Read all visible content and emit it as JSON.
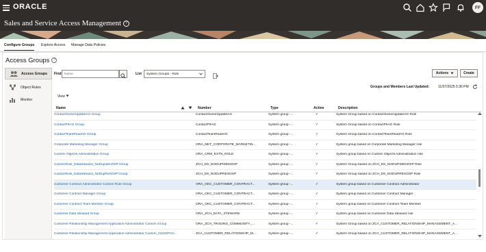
{
  "header": {
    "brand": "ORACLE",
    "page_title": "Sales and Service Access Management",
    "help_glyph": "?",
    "user_initials": "FF",
    "icons": [
      "hamburger-icon",
      "search-icon",
      "home-icon",
      "star-icon",
      "flag-icon",
      "bell-icon"
    ]
  },
  "tabs": [
    "Configure Groups",
    "Explore Access",
    "Manage Data Policies"
  ],
  "section": {
    "title": "Access Groups",
    "help_glyph": "?"
  },
  "leftnav": [
    {
      "label": "Access Groups",
      "icon": "access-groups-icon",
      "active": true
    },
    {
      "label": "Object Rules",
      "icon": "object-rules-icon",
      "active": false
    },
    {
      "label": "Monitor",
      "icon": "monitor-icon",
      "active": false
    }
  ],
  "toolbar": {
    "find_label": "Find",
    "find_placeholder": "Name",
    "list_label": "List",
    "list_value": "System Groups - Role",
    "actions_label": "Actions",
    "create_label": "Create",
    "last_updated_label": "Groups and Members Last Updated:",
    "last_updated_value": "11/07/2025 5:36 PM",
    "view_label": "View"
  },
  "columns": [
    "Name",
    "Number",
    "Type",
    "Active",
    "Description"
  ],
  "rows": [
    {
      "name": "ContactOwnerUpdateAG Group",
      "number": "ContactOwnerUpdateAG",
      "type": "System group -...",
      "active": "✓",
      "description": "System Group based on ContactOwnerUpdateAG Role"
    },
    {
      "name": "ContactPIIAG Group",
      "number": "ContactPIIAG",
      "type": "System group -...",
      "active": "✓",
      "description": "System Group based on ContactPIIAG Role"
    },
    {
      "name": "ContactTeamReadAG Group",
      "number": "ContactTeamReadAG",
      "type": "System group -...",
      "active": "✓",
      "description": "System Group based on ContactTeamReadAG Role"
    },
    {
      "name": "Corporate Marketing Manager Group",
      "number": "ORA_MKT_CORPORATE_MARKETIN...",
      "type": "System group -...",
      "active": "✓",
      "description": "System group based on Corporate Marketing Manager role"
    },
    {
      "name": "Custom Objects Administration Group",
      "number": "ORA_CRM_EXTN_ROLE",
      "type": "System group -...",
      "active": "✓",
      "description": "System group based on Custom Objects Administration role"
    },
    {
      "name": "CustomRole_DataSteward_NoDupIdenOSP Group",
      "number": "ZCH_DS_NODUPIDENOSP",
      "type": "System group -...",
      "active": "✓",
      "description": "System Group based on ZCH_DS_NODUPIDENOSP Role"
    },
    {
      "name": "CustomRole_DataSteward_NoDupResOSP Group",
      "number": "ZCH_DS_NODUPRESOSP",
      "type": "System group -...",
      "active": "✓",
      "description": "System Group based on ZCH_DS_NODUPRESOSP Role"
    },
    {
      "name": "Customer Contract Administrator Custom Role Group",
      "number": "ORA_OKC_CUSTOMER_CONTRACT...",
      "type": "System group -...",
      "active": "✓",
      "description": "System group based on Customer Contract Administrator"
    },
    {
      "name": "Customer Contract Manager Group",
      "number": "ORA_OKC_CUSTOMER_CONTRACT...",
      "type": "System group -...",
      "active": "✓",
      "description": "System group based on Customer Contract Manager"
    },
    {
      "name": "Customer Contract Team Member Group",
      "number": "ORA_OKC_CUSTOMER_CONTRACT...",
      "type": "System group -...",
      "active": "✓",
      "description": "System group based on Customer Contract Team Member"
    },
    {
      "name": "Customer Data Steward Group",
      "number": "ORA_ZCH_DATA_STEWARD",
      "type": "System group -...",
      "active": "✓",
      "description": "System group based on Customer Data Steward role"
    },
    {
      "name": "Customer Relationship Management Application Administrator Custom Group",
      "number": "ORA_ZCH_TRADING_COMMUNITY_...",
      "type": "System group -...",
      "active": "✓",
      "description": "System Group based on ZCA_CUSTOMER_RELATIONSHIP_MANAGEMENT_A..."
    },
    {
      "name": "Customer Relationship Management Application Administrator Custom_NoOSPAG...",
      "number": "ZCA_CUSTOMER_RELATIONSHIP_M...",
      "type": "System group -...",
      "active": "✓",
      "description": "System Group based on ZCA_CUSTOMER_RELATIONSHIP_MANAGEMENT_A..."
    }
  ],
  "selected_row_index": 7,
  "colors": {
    "header_bg": "#312d2a",
    "link": "#1f5da3",
    "selected_row": "#e3eef8"
  }
}
